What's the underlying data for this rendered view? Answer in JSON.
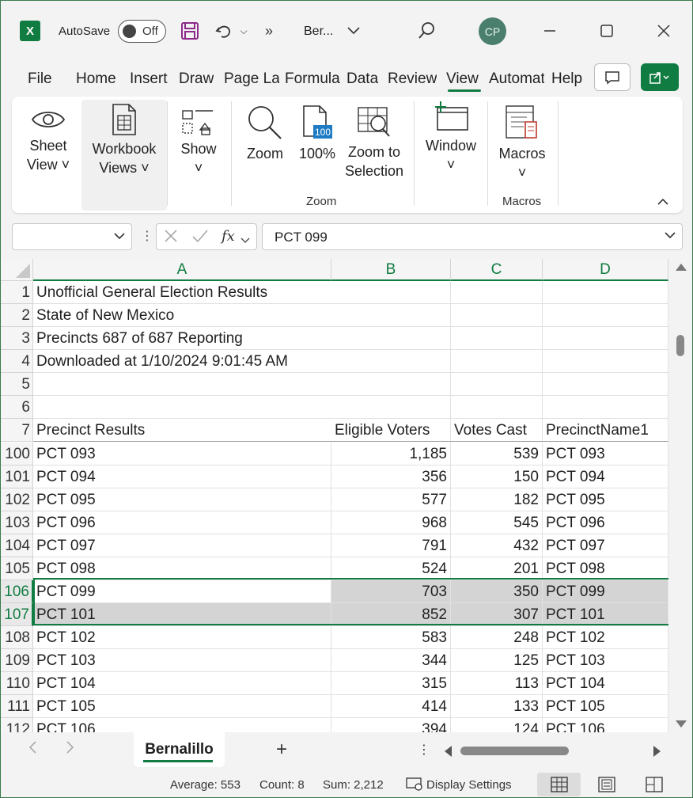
{
  "app": {
    "logo_letter": "X",
    "autosave_label": "AutoSave",
    "autosave_state": "Off",
    "doc_title": "Ber...",
    "avatar_initials": "CP",
    "accent_color": "#107c41"
  },
  "menu": {
    "tabs": [
      "File",
      "Home",
      "Insert",
      "Draw",
      "Page Layout",
      "Formulas",
      "Data",
      "Review",
      "View",
      "Automate",
      "Help"
    ],
    "active_tab": "View"
  },
  "ribbon": {
    "sheet_view": [
      "Sheet",
      "View ˅"
    ],
    "workbook_views": [
      "Workbook",
      "Views ˅"
    ],
    "show": [
      "Show",
      "˅"
    ],
    "zoom": "Zoom",
    "zoom100": "100%",
    "zoom_icon_badge": "100",
    "zoom_to_selection": [
      "Zoom to",
      "Selection"
    ],
    "window": [
      "Window",
      "˅"
    ],
    "macros": [
      "Macros",
      "˅"
    ],
    "group_zoom": "Zoom",
    "group_macros": "Macros"
  },
  "formula_bar": {
    "name_box": "",
    "fx_label": "fx",
    "value": "PCT 099"
  },
  "sheet": {
    "columns": [
      "A",
      "B",
      "C",
      "D"
    ],
    "header_rows": [
      {
        "num": "1",
        "a": "Unofficial General Election Results",
        "b": "",
        "c": "",
        "d": ""
      },
      {
        "num": "2",
        "a": "State of New Mexico",
        "b": "",
        "c": "",
        "d": ""
      },
      {
        "num": "3",
        "a": "Precincts 687 of 687 Reporting",
        "b": "",
        "c": "",
        "d": ""
      },
      {
        "num": "4",
        "a": "Downloaded at 1/10/2024 9:01:45 AM",
        "b": "",
        "c": "",
        "d": ""
      },
      {
        "num": "5",
        "a": "",
        "b": "",
        "c": "",
        "d": ""
      },
      {
        "num": "6",
        "a": "",
        "b": "",
        "c": "",
        "d": ""
      },
      {
        "num": "7",
        "a": "Precinct Results",
        "b": "Eligible Voters",
        "c": "Votes Cast",
        "d": "PrecinctName1"
      }
    ],
    "data_rows": [
      {
        "num": "100",
        "a": "PCT 093",
        "b": "1,185",
        "c": "539",
        "d": "PCT 093"
      },
      {
        "num": "101",
        "a": "PCT 094",
        "b": "356",
        "c": "150",
        "d": "PCT 094"
      },
      {
        "num": "102",
        "a": "PCT 095",
        "b": "577",
        "c": "182",
        "d": "PCT 095"
      },
      {
        "num": "103",
        "a": "PCT 096",
        "b": "968",
        "c": "545",
        "d": "PCT 096"
      },
      {
        "num": "104",
        "a": "PCT 097",
        "b": "791",
        "c": "432",
        "d": "PCT 097"
      },
      {
        "num": "105",
        "a": "PCT 098",
        "b": "524",
        "c": "201",
        "d": "PCT 098"
      },
      {
        "num": "106",
        "a": "PCT 099",
        "b": "703",
        "c": "350",
        "d": "PCT 099"
      },
      {
        "num": "107",
        "a": "PCT 101",
        "b": "852",
        "c": "307",
        "d": "PCT 101"
      },
      {
        "num": "108",
        "a": "PCT 102",
        "b": "583",
        "c": "248",
        "d": "PCT 102"
      },
      {
        "num": "109",
        "a": "PCT 103",
        "b": "344",
        "c": "125",
        "d": "PCT 103"
      },
      {
        "num": "110",
        "a": "PCT 104",
        "b": "315",
        "c": "113",
        "d": "PCT 104"
      },
      {
        "num": "111",
        "a": "PCT 105",
        "b": "414",
        "c": "133",
        "d": "PCT 105"
      },
      {
        "num": "112",
        "a": "PCT 106",
        "b": "394",
        "c": "124",
        "d": "PCT 106"
      }
    ],
    "selected_rows": [
      "106",
      "107"
    ]
  },
  "sheet_tabs": {
    "active": "Bernalillo",
    "add_label": "+"
  },
  "status": {
    "average": "Average: 553",
    "count": "Count: 8",
    "sum": "Sum: 2,212",
    "display_settings": "Display Settings"
  }
}
